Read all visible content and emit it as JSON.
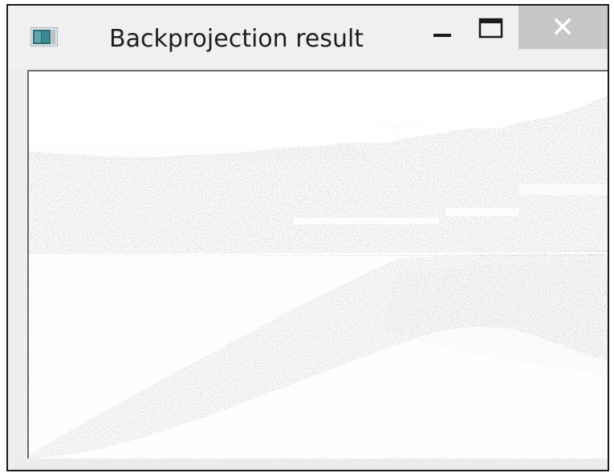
{
  "window": {
    "title": "Backprojection result",
    "icon": "app-window-icon",
    "controls": {
      "minimize_icon": "minimize-icon",
      "maximize_icon": "maximize-icon",
      "close_icon": "close-icon"
    }
  },
  "image": {
    "description_icon": "backprojection-image",
    "colors": {
      "foreground": "#a9a9a9",
      "background": "#ffffff",
      "titlebar": "#f0f0f0",
      "close_button": "#c7c7c7"
    }
  }
}
